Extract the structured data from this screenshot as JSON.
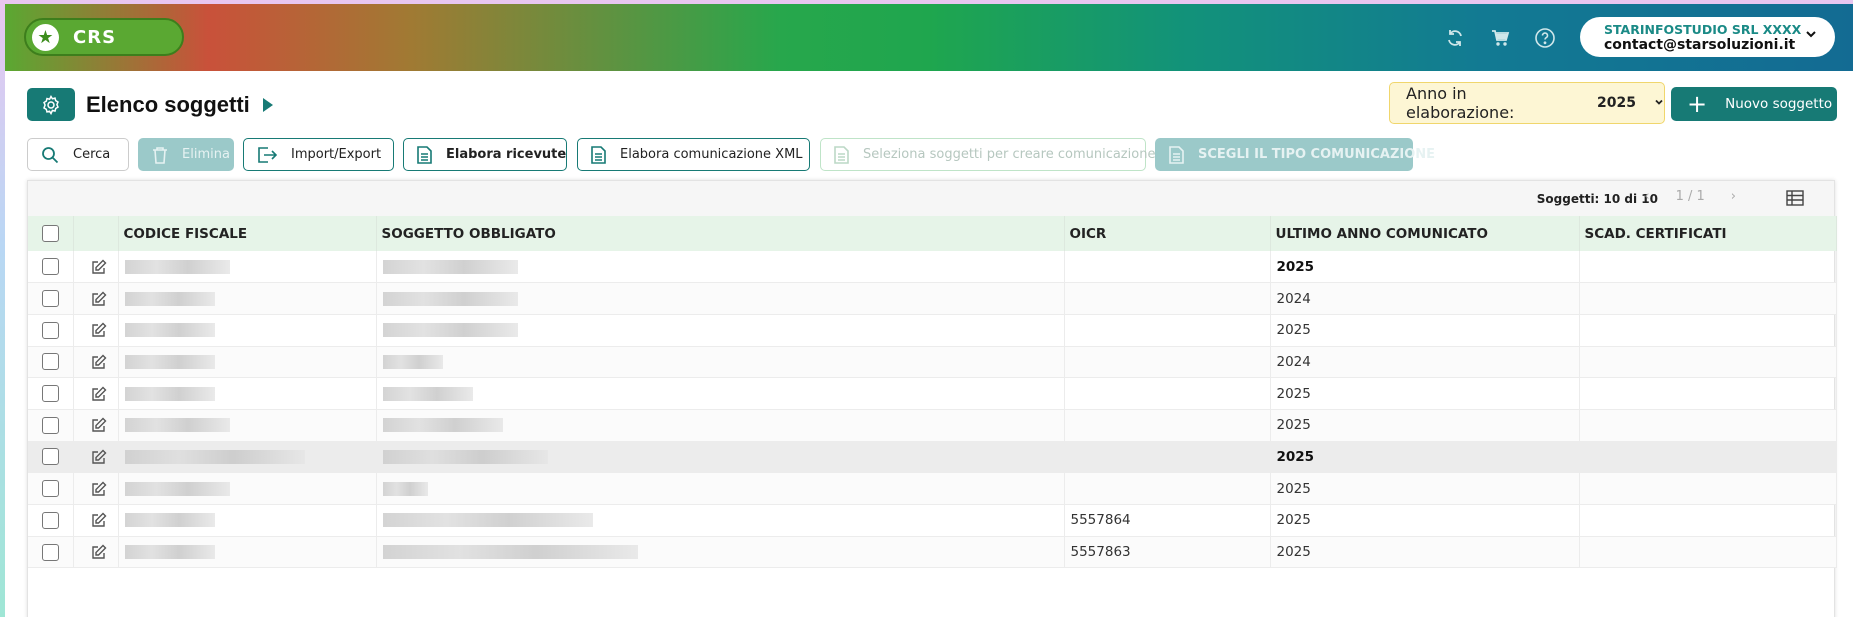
{
  "header": {
    "app_name": "CRS",
    "company": "STARINFOSTUDIO SRL XXXX",
    "email": "contact@starsoluzioni.it"
  },
  "page": {
    "title": "Elenco soggetti",
    "year_label": "Anno in elaborazione:",
    "year_value": "2025",
    "new_label": "Nuovo soggetto"
  },
  "toolbar": {
    "search": "Cerca",
    "delete": "Elimina",
    "import_export": "Import/Export",
    "receipts": "Elabora ricevute",
    "xml": "Elabora comunicazione XML",
    "select_subjects": "Seleziona soggetti per creare comunicazione",
    "choose_type": "SCEGLI IL TIPO COMUNICAZIONE"
  },
  "grid": {
    "count": "Soggetti: 10 di 10",
    "page": "1 / 1",
    "columns": [
      "CODICE FISCALE",
      "SOGGETTO OBBLIGATO",
      "OICR",
      "ULTIMO ANNO COMUNICATO",
      "SCAD. CERTIFICATI"
    ],
    "rows": [
      {
        "oicr": "",
        "year": "2025",
        "bold": true
      },
      {
        "oicr": "",
        "year": "2024",
        "bold": false
      },
      {
        "oicr": "",
        "year": "2025",
        "bold": false
      },
      {
        "oicr": "",
        "year": "2024",
        "bold": false
      },
      {
        "oicr": "",
        "year": "2025",
        "bold": false
      },
      {
        "oicr": "",
        "year": "2025",
        "bold": false
      },
      {
        "oicr": "",
        "year": "2025",
        "bold": true
      },
      {
        "oicr": "",
        "year": "2025",
        "bold": false
      },
      {
        "oicr": "5557864",
        "year": "2025",
        "bold": false
      },
      {
        "oicr": "5557863",
        "year": "2025",
        "bold": false
      }
    ]
  },
  "colors": {
    "accent": "#177a75",
    "header_green": "#e6f4e8",
    "year_bg": "#fdf6d4"
  },
  "icons": [
    "star-icon",
    "refresh-icon",
    "cart-icon",
    "help-icon",
    "chevron-down-icon",
    "gear-icon",
    "search-icon",
    "trash-icon",
    "export-icon",
    "document-icon",
    "plus-icon",
    "edit-icon",
    "table-icon"
  ]
}
